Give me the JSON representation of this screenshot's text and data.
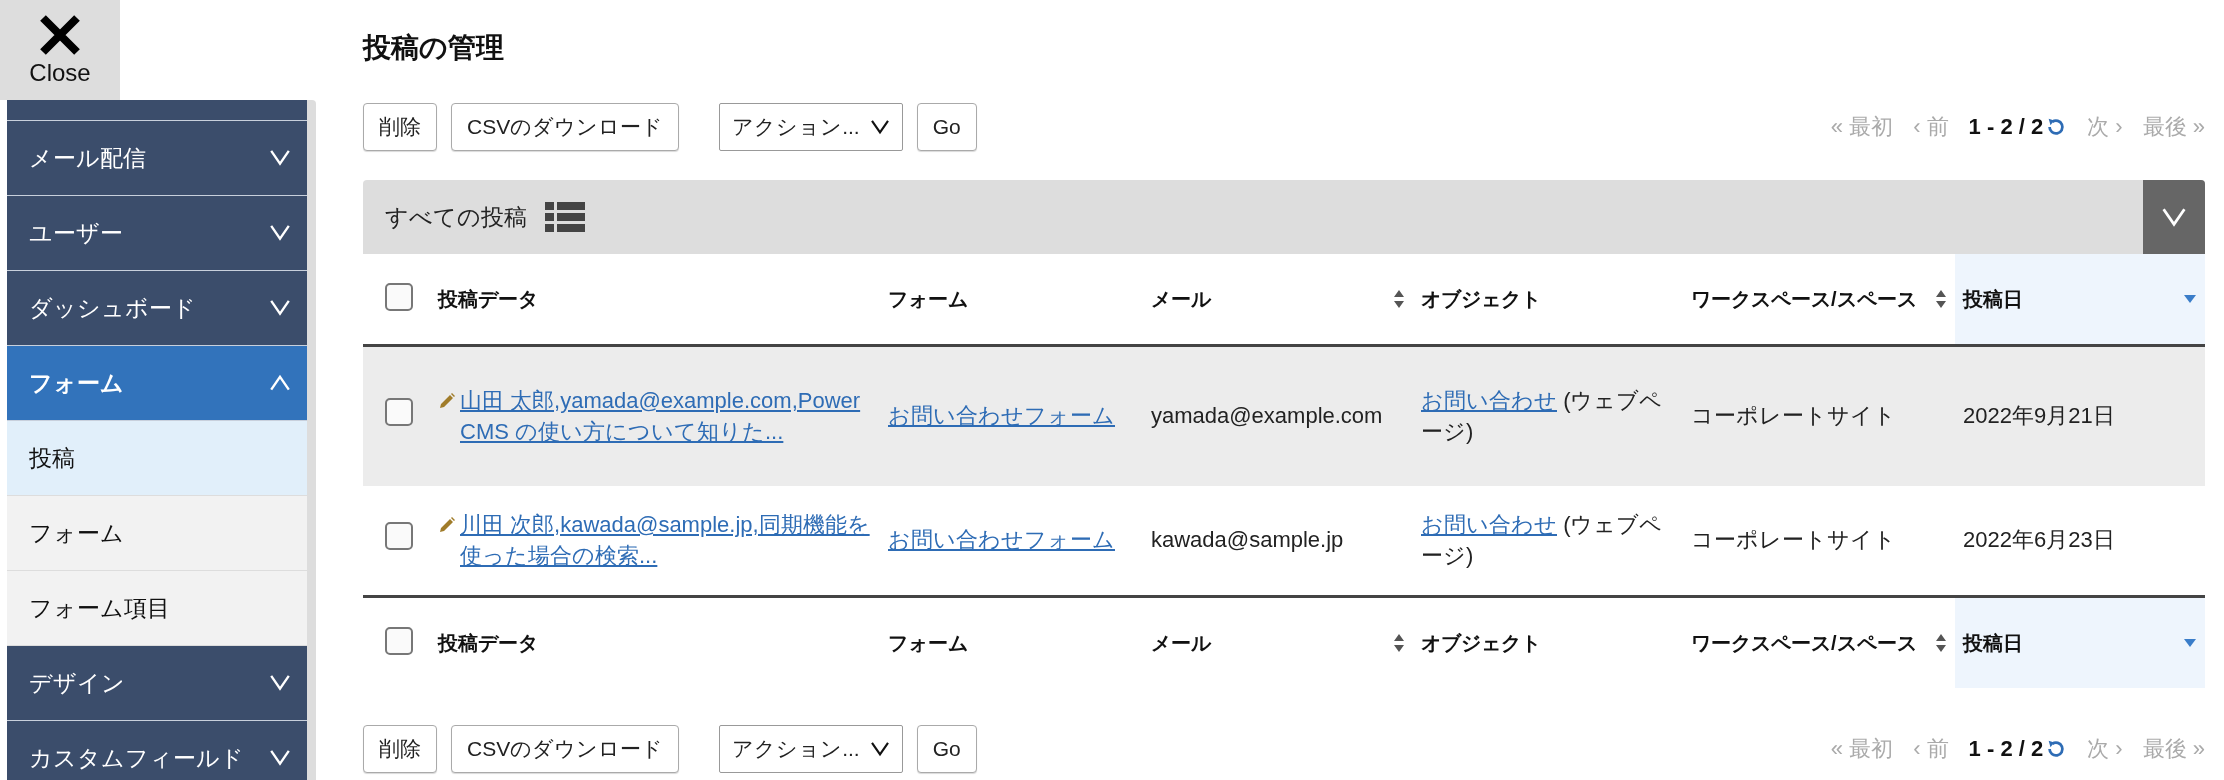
{
  "close_button": {
    "label": "Close"
  },
  "sidebar": {
    "items": [
      {
        "label": "メール配信",
        "expanded": false,
        "selected": false
      },
      {
        "label": "ユーザー",
        "expanded": false,
        "selected": false
      },
      {
        "label": "ダッシュボード",
        "expanded": false,
        "selected": false
      },
      {
        "label": "フォーム",
        "expanded": true,
        "selected": true,
        "children": [
          {
            "label": "投稿",
            "selected": true
          },
          {
            "label": "フォーム",
            "selected": false
          },
          {
            "label": "フォーム項目",
            "selected": false
          }
        ]
      },
      {
        "label": "デザイン",
        "expanded": false,
        "selected": false
      },
      {
        "label": "カスタムフィールド",
        "expanded": false,
        "selected": false
      }
    ]
  },
  "page_title": "投稿の管理",
  "toolbars": [
    {
      "buttons": [
        "削除",
        "CSVのダウンロード"
      ],
      "action_select": "アクション...",
      "go": "Go",
      "pagination": {
        "first": {
          "label": "« 最初",
          "disabled": true
        },
        "prev": {
          "label": "‹ 前",
          "disabled": true
        },
        "range": "1 - 2 / 2",
        "next": {
          "label": "次 ›",
          "disabled": true
        },
        "last": {
          "label": "最後 »",
          "disabled": true
        }
      }
    },
    {
      "buttons": [
        "削除",
        "CSVのダウンロード"
      ],
      "action_select": "アクション...",
      "go": "Go",
      "pagination": {
        "first": {
          "label": "« 最初",
          "disabled": true
        },
        "prev": {
          "label": "‹ 前",
          "disabled": true
        },
        "range": "1 - 2 / 2",
        "next": {
          "label": "次 ›",
          "disabled": true
        },
        "last": {
          "label": "最後 »",
          "disabled": true
        }
      }
    }
  ],
  "filter": {
    "label": "すべての投稿",
    "expanded": false
  },
  "table": {
    "columns": [
      {
        "label": "投稿データ",
        "sortable": false,
        "sorted": false
      },
      {
        "label": "フォーム",
        "sortable": false,
        "sorted": false
      },
      {
        "label": "メール",
        "sortable": true,
        "sorted": false
      },
      {
        "label": "オブジェクト",
        "sortable": false,
        "sorted": false
      },
      {
        "label": "ワークスペース/スペース",
        "sortable": true,
        "sorted": false
      },
      {
        "label": "投稿日",
        "sortable": true,
        "sorted": true
      }
    ],
    "header_checked": false,
    "rows": [
      {
        "checked": false,
        "highlighted": true,
        "data": "山田 太郎,yamada@example.com,PowerCMS の使い方について知りた...",
        "form": "お問い合わせフォーム",
        "email": "yamada@example.com",
        "object_link": "お問い合わせ",
        "object_type": "(ウェブページ)",
        "workspace": "コーポレートサイト",
        "date": "2022年9月21日"
      },
      {
        "checked": false,
        "highlighted": false,
        "data": "川田 次郎,kawada@sample.jp,同期機能を使った場合の検索...",
        "form": "お問い合わせフォーム",
        "email": "kawada@sample.jp",
        "object_link": "お問い合わせ",
        "object_type": "(ウェブページ)",
        "workspace": "コーポレートサイト",
        "date": "2022年6月23日"
      }
    ],
    "footer_columns": [
      {
        "label": "投稿データ",
        "sortable": false,
        "sorted": false
      },
      {
        "label": "フォーム",
        "sortable": false,
        "sorted": false
      },
      {
        "label": "メール",
        "sortable": true,
        "sorted": false
      },
      {
        "label": "オブジェクト",
        "sortable": false,
        "sorted": false
      },
      {
        "label": "ワークスペース/スペース",
        "sortable": true,
        "sorted": false
      },
      {
        "label": "投稿日",
        "sortable": true,
        "sorted": true
      }
    ],
    "footer_checked": false
  }
}
